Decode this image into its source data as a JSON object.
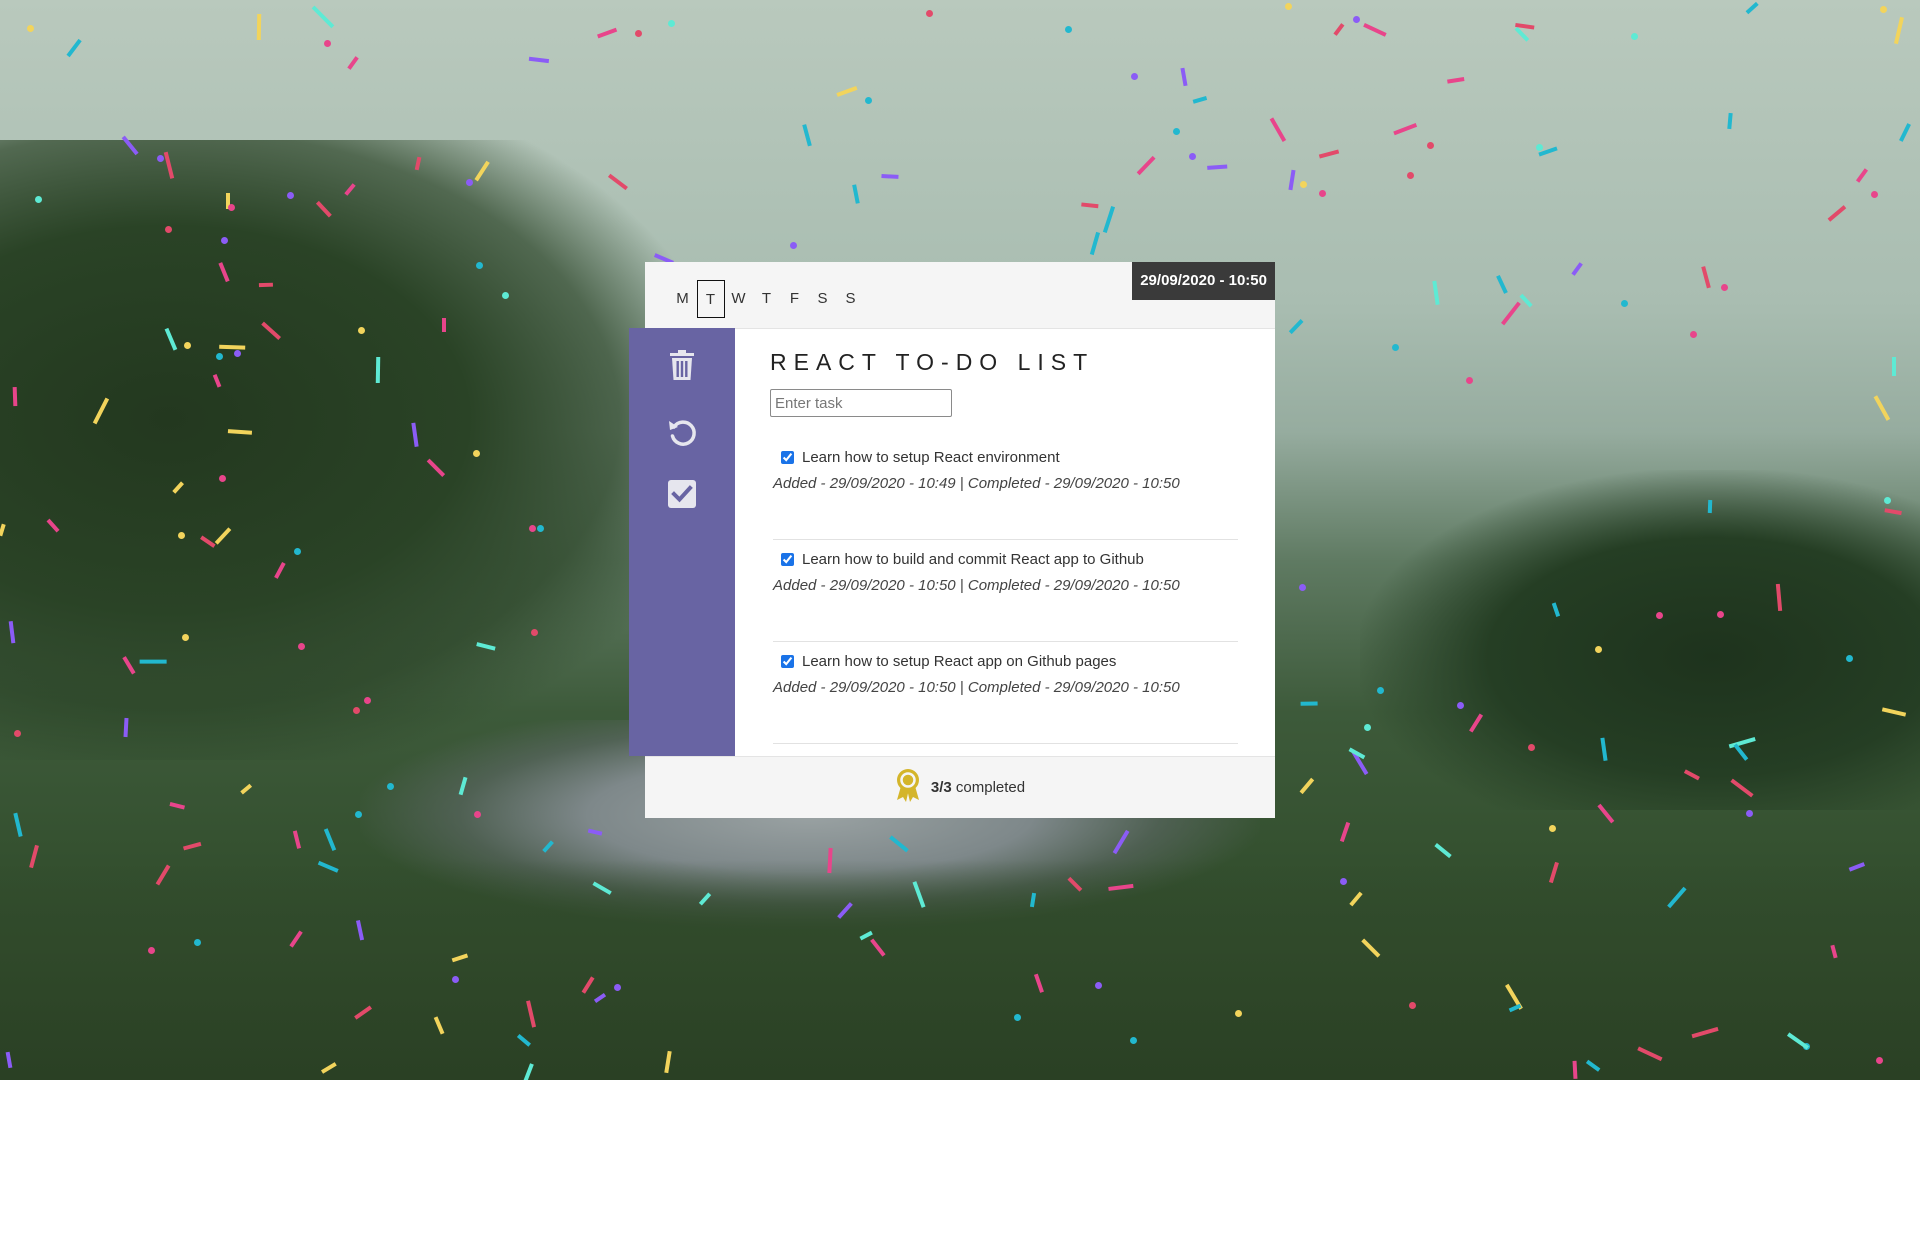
{
  "header": {
    "days": [
      "M",
      "T",
      "W",
      "T",
      "F",
      "S",
      "S"
    ],
    "active_day_index": 1,
    "datetime": "29/09/2020 - 10:50"
  },
  "sidebar": {
    "items": [
      {
        "icon": "trash-icon",
        "label": "Delete"
      },
      {
        "icon": "undo-icon",
        "label": "Undo"
      },
      {
        "icon": "check-square-icon",
        "label": "Complete"
      }
    ],
    "color": "#6864a3"
  },
  "main": {
    "title": "REACT TO-DO LIST",
    "input": {
      "placeholder": "Enter task",
      "value": ""
    },
    "tasks": [
      {
        "text": "Learn how to setup React environment",
        "checked": true,
        "meta": "Added - 29/09/2020 - 10:49 | Completed - 29/09/2020 - 10:50"
      },
      {
        "text": "Learn how to build and commit React app to Github",
        "checked": true,
        "meta": "Added - 29/09/2020 - 10:50 | Completed - 29/09/2020 - 10:50"
      },
      {
        "text": "Learn how to setup React app on Github pages",
        "checked": true,
        "meta": "Added - 29/09/2020 - 10:50 | Completed - 29/09/2020 - 10:50"
      }
    ]
  },
  "footer": {
    "icon": "award-ribbon-icon",
    "count": "3/3",
    "label": "completed",
    "accent": "#d4b52a"
  }
}
